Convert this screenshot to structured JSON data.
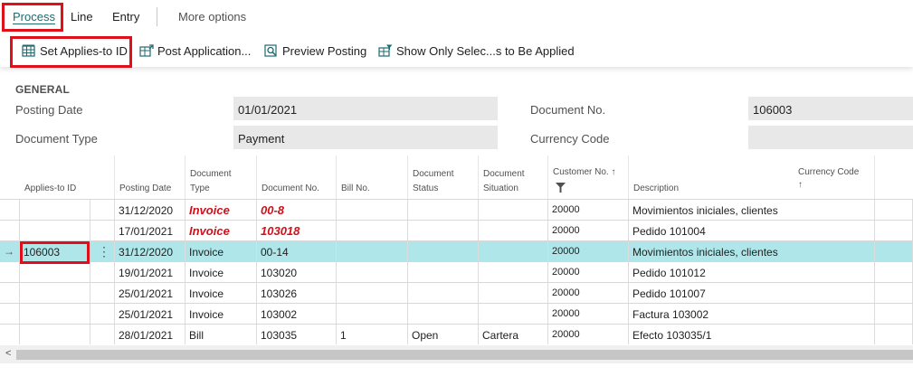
{
  "tabs": {
    "process": "Process",
    "line": "Line",
    "entry": "Entry",
    "more": "More options"
  },
  "actions": {
    "set_applies_to_id": "Set Applies-to ID",
    "post_application": "Post Application...",
    "preview_posting": "Preview Posting",
    "show_only_selected": "Show Only Selec...s to Be Applied"
  },
  "general": {
    "title": "GENERAL",
    "posting_date_label": "Posting Date",
    "posting_date_value": "01/01/2021",
    "document_type_label": "Document Type",
    "document_type_value": "Payment",
    "document_no_label": "Document No.",
    "document_no_value": "106003",
    "currency_code_label": "Currency Code",
    "currency_code_value": ""
  },
  "grid": {
    "headers": {
      "applies_to_id": "Applies-to ID",
      "posting_date": "Posting Date",
      "document_type_1": "Document",
      "document_type_2": "Type",
      "document_no": "Document No.",
      "bill_no": "Bill No.",
      "document_status_1": "Document",
      "document_status_2": "Status",
      "document_situation_1": "Document",
      "document_situation_2": "Situation",
      "customer_no": "Customer No. ↑",
      "description": "Description",
      "currency_code_1": "Currency Code",
      "currency_code_2": "↑"
    },
    "rows": [
      {
        "applies_to_id": "",
        "posting_date": "31/12/2020",
        "document_type": "Invoice",
        "document_no": "00-8",
        "bill_no": "",
        "status": "",
        "situation": "",
        "customer_no": "20000",
        "description": "Movimientos iniciales, clientes",
        "emphasis": true
      },
      {
        "applies_to_id": "",
        "posting_date": "17/01/2021",
        "document_type": "Invoice",
        "document_no": "103018",
        "bill_no": "",
        "status": "",
        "situation": "",
        "customer_no": "20000",
        "description": "Pedido 101004",
        "emphasis": true
      },
      {
        "applies_to_id": "106003",
        "posting_date": "31/12/2020",
        "document_type": "Invoice",
        "document_no": "00-14",
        "bill_no": "",
        "status": "",
        "situation": "",
        "customer_no": "20000",
        "description": "Movimientos iniciales, clientes",
        "selected": true
      },
      {
        "applies_to_id": "",
        "posting_date": "19/01/2021",
        "document_type": "Invoice",
        "document_no": "103020",
        "bill_no": "",
        "status": "",
        "situation": "",
        "customer_no": "20000",
        "description": "Pedido 101012"
      },
      {
        "applies_to_id": "",
        "posting_date": "25/01/2021",
        "document_type": "Invoice",
        "document_no": "103026",
        "bill_no": "",
        "status": "",
        "situation": "",
        "customer_no": "20000",
        "description": "Pedido 101007"
      },
      {
        "applies_to_id": "",
        "posting_date": "25/01/2021",
        "document_type": "Invoice",
        "document_no": "103002",
        "bill_no": "",
        "status": "",
        "situation": "",
        "customer_no": "20000",
        "description": "Factura 103002"
      },
      {
        "applies_to_id": "",
        "posting_date": "28/01/2021",
        "document_type": "Bill",
        "document_no": "103035",
        "bill_no": "1",
        "status": "Open",
        "situation": "Cartera",
        "customer_no": "20000",
        "description": "Efecto 103035/1"
      }
    ],
    "selected_row_marker": "→",
    "row_menu": "⋮"
  },
  "scrollbar": {
    "left_arrow": "<"
  },
  "colors": {
    "accent": "#1e6a6f",
    "highlight_box": "#e0101a",
    "selected_row": "#aee6ea",
    "emphasis_text": "#d0101a"
  }
}
